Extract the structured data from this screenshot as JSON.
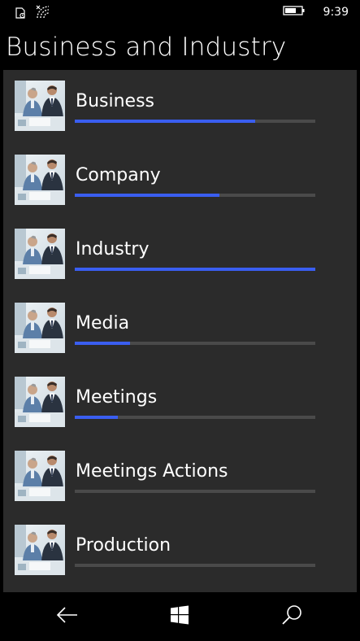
{
  "status_bar": {
    "time": "9:39",
    "icons": [
      "notification-icon",
      "wifi-icon",
      "battery-icon"
    ]
  },
  "page": {
    "title": "Business and Industry"
  },
  "items": [
    {
      "label": "Business",
      "progress": 0.75,
      "thumbnail": "business-meeting-photo"
    },
    {
      "label": "Company",
      "progress": 0.6,
      "thumbnail": "business-meeting-photo"
    },
    {
      "label": "Industry",
      "progress": 1.0,
      "thumbnail": "business-meeting-photo"
    },
    {
      "label": "Media",
      "progress": 0.23,
      "thumbnail": "business-meeting-photo"
    },
    {
      "label": "Meetings",
      "progress": 0.18,
      "thumbnail": "business-meeting-photo"
    },
    {
      "label": "Meetings Actions",
      "progress": 0.0,
      "thumbnail": "business-meeting-photo"
    },
    {
      "label": "Production",
      "progress": 0.0,
      "thumbnail": "business-meeting-photo"
    }
  ],
  "nav": {
    "icons": [
      "back-arrow-icon",
      "windows-logo-icon",
      "search-icon"
    ]
  },
  "colors": {
    "background": "#000000",
    "panel": "#2b2b2b",
    "accent": "#3a5ef0",
    "track": "#4a4a4a"
  }
}
